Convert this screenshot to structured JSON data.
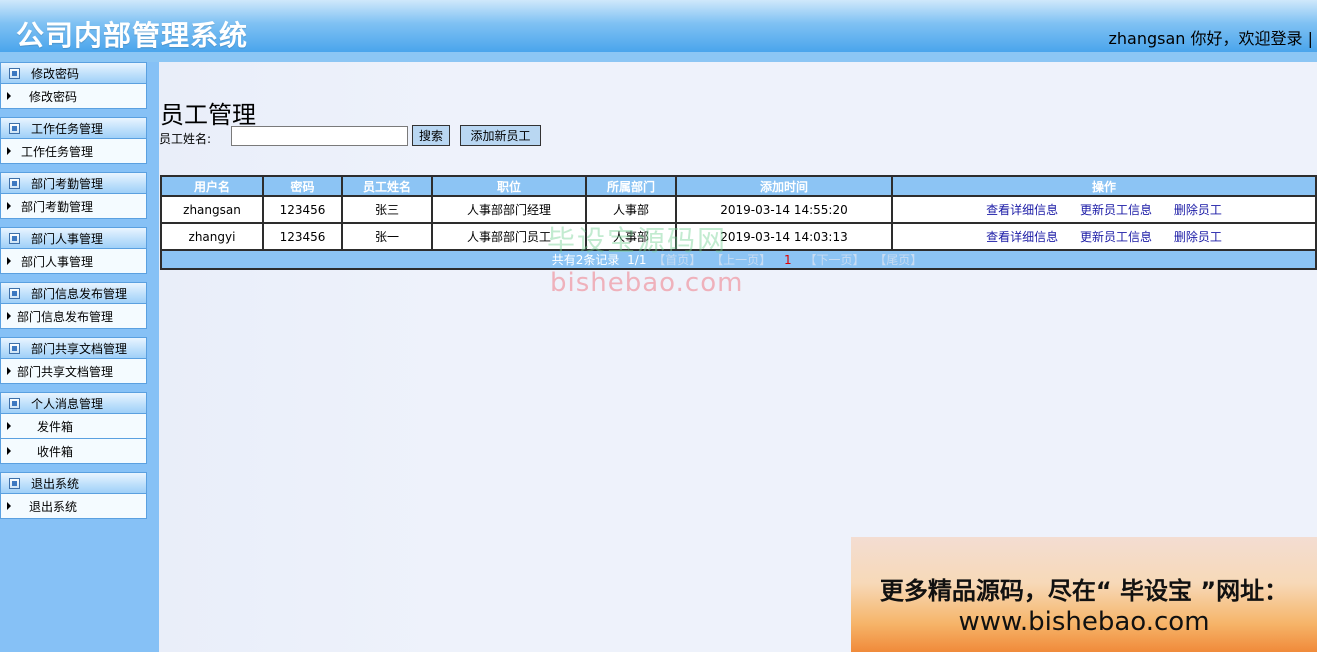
{
  "header": {
    "app_title": "公司内部管理系统",
    "greeting": "zhangsan 你好，欢迎登录 |"
  },
  "sidebar": {
    "groups": [
      {
        "title": "修改密码",
        "items": [
          "修改密码"
        ]
      },
      {
        "title": "工作任务管理",
        "items": [
          "工作任务管理"
        ]
      },
      {
        "title": "部门考勤管理",
        "items": [
          "部门考勤管理"
        ]
      },
      {
        "title": "部门人事管理",
        "items": [
          "部门人事管理"
        ]
      },
      {
        "title": "部门信息发布管理",
        "items": [
          "部门信息发布管理"
        ]
      },
      {
        "title": "部门共享文档管理",
        "items": [
          "部门共享文档管理"
        ]
      },
      {
        "title": "个人消息管理",
        "items": [
          "发件箱",
          "收件箱"
        ]
      },
      {
        "title": "退出系统",
        "items": [
          "退出系统"
        ]
      }
    ]
  },
  "main": {
    "page_title": "员工管理",
    "search_label": "员工姓名:",
    "search_value": "",
    "search_button": "搜索",
    "add_button": "添加新员工",
    "table": {
      "headers": [
        "用户名",
        "密码",
        "员工姓名",
        "职位",
        "所属部门",
        "添加时间",
        "操作"
      ],
      "rows": [
        {
          "username": "zhangsan",
          "password": "123456",
          "name": "张三",
          "position": "人事部部门经理",
          "department": "人事部",
          "time": "2019-03-14 14:55:20"
        },
        {
          "username": "zhangyi",
          "password": "123456",
          "name": "张一",
          "position": "人事部部门员工",
          "department": "人事部",
          "time": "2019-03-14 14:03:13"
        }
      ],
      "actions": [
        "查看详细信息",
        "更新员工信息",
        "删除员工"
      ]
    },
    "pager": {
      "summary": "共有2条记录",
      "page_info": "1/1",
      "first": "【首页】",
      "prev": "【上一页】",
      "current": "1",
      "next": "【下一页】",
      "last": "【尾页】"
    }
  },
  "watermark": {
    "cn": "毕设宝源码网",
    "en": "bishebao.com"
  },
  "ad": {
    "line1": "更多精品源码，尽在“ 毕设宝 ”网址：",
    "line2": "www.bishebao.com"
  }
}
